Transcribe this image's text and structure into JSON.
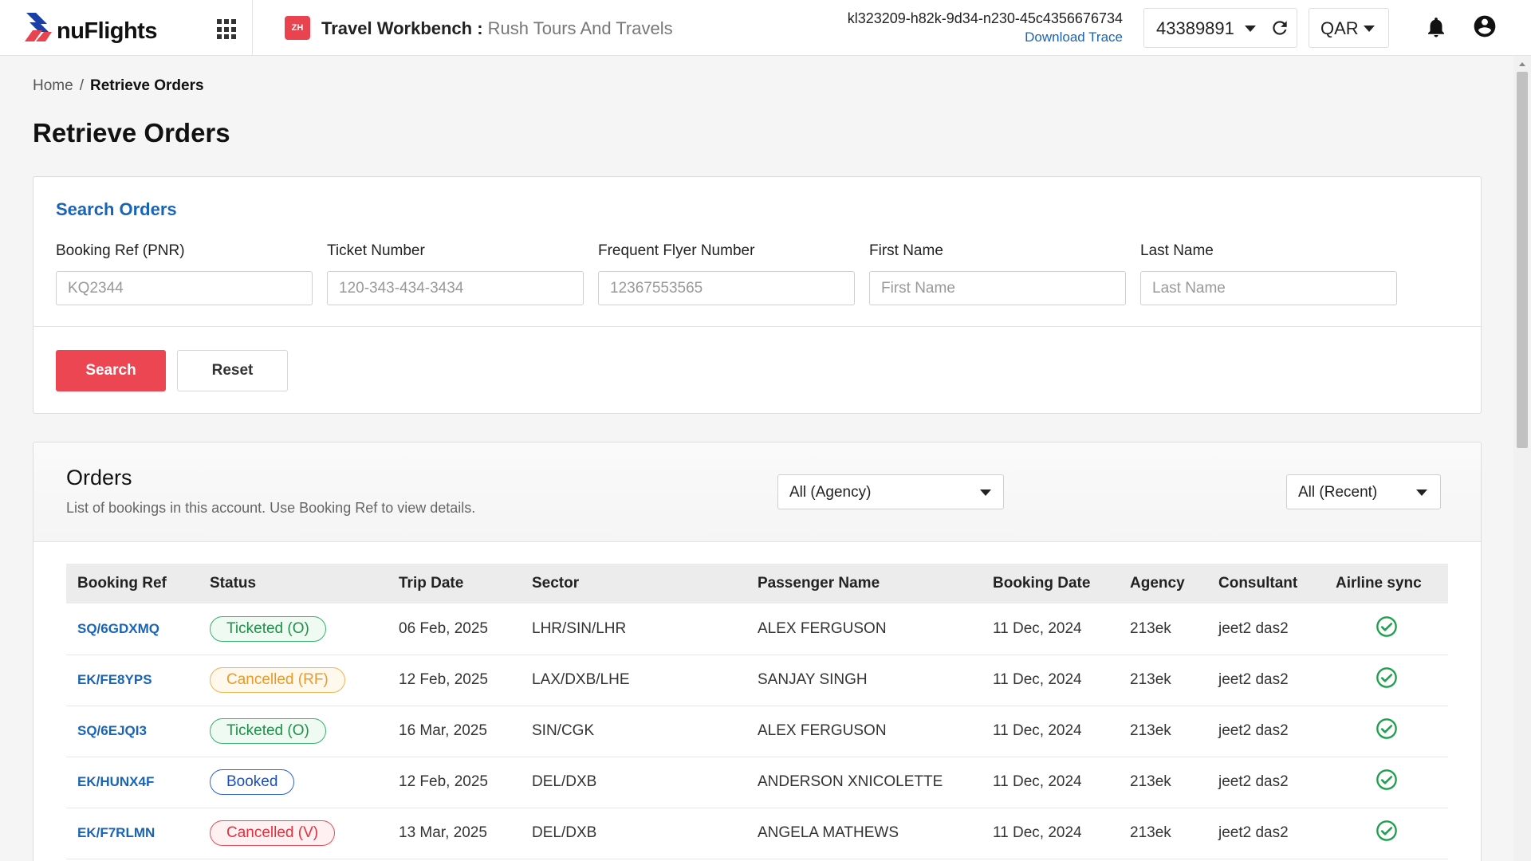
{
  "app": {
    "logo_text": "nuFlights",
    "workbench_icon_text": "ZH",
    "workbench_title": "Travel Workbench :",
    "agency_name": "Rush Tours And Travels",
    "trace_id": "kl323209-h82k-9d34-n230-45c4356676734",
    "download_trace_label": "Download Trace",
    "account_number": "43389891",
    "currency": "QAR"
  },
  "icons": {
    "apps": "grid-icon",
    "refresh": "refresh-icon",
    "notifications": "bell-icon",
    "user": "user-icon",
    "sync": "check-circle-icon"
  },
  "breadcrumb": {
    "home": "Home",
    "separator": "/",
    "current": "Retrieve Orders"
  },
  "page_title": "Retrieve Orders",
  "search": {
    "heading": "Search Orders",
    "fields": [
      {
        "label": "Booking Ref (PNR)",
        "placeholder": "KQ2344",
        "value": ""
      },
      {
        "label": "Ticket Number",
        "placeholder": "120-343-434-3434",
        "value": ""
      },
      {
        "label": "Frequent Flyer Number",
        "placeholder": "12367553565",
        "value": ""
      },
      {
        "label": "First Name",
        "placeholder": "First Name",
        "value": ""
      },
      {
        "label": "Last Name",
        "placeholder": "Last Name",
        "value": ""
      }
    ],
    "search_label": "Search",
    "reset_label": "Reset"
  },
  "orders": {
    "title": "Orders",
    "subtitle": "List of bookings in this account. Use Booking Ref to view details.",
    "agency_filter": "All (Agency)",
    "recent_filter": "All (Recent)",
    "columns": [
      "Booking Ref",
      "Status",
      "Trip Date",
      "Sector",
      "Passenger Name",
      "Booking Date",
      "Agency",
      "Consultant",
      "Airline sync"
    ],
    "rows": [
      {
        "ref": "SQ/6GDXMQ",
        "status": "Ticketed (O)",
        "status_kind": "ticketed",
        "trip_date": "06 Feb, 2025",
        "sector": "LHR/SIN/LHR",
        "passenger": "ALEX FERGUSON",
        "booking_date": "11 Dec, 2024",
        "agency": "213ek",
        "consultant": "jeet2 das2"
      },
      {
        "ref": "EK/FE8YPS",
        "status": "Cancelled (RF)",
        "status_kind": "cancelled-rf",
        "trip_date": "12 Feb, 2025",
        "sector": "LAX/DXB/LHE",
        "passenger": "SANJAY SINGH",
        "booking_date": "11 Dec, 2024",
        "agency": "213ek",
        "consultant": "jeet2 das2"
      },
      {
        "ref": "SQ/6EJQI3",
        "status": "Ticketed (O)",
        "status_kind": "ticketed",
        "trip_date": "16 Mar, 2025",
        "sector": "SIN/CGK",
        "passenger": "ALEX FERGUSON",
        "booking_date": "11 Dec, 2024",
        "agency": "213ek",
        "consultant": "jeet2 das2"
      },
      {
        "ref": "EK/HUNX4F",
        "status": "Booked",
        "status_kind": "booked",
        "trip_date": "12 Feb, 2025",
        "sector": "DEL/DXB",
        "passenger": "ANDERSON XNICOLETTE",
        "booking_date": "11 Dec, 2024",
        "agency": "213ek",
        "consultant": "jeet2 das2"
      },
      {
        "ref": "EK/F7RLMN",
        "status": "Cancelled (V)",
        "status_kind": "cancelled-v",
        "trip_date": "13 Mar, 2025",
        "sector": "DEL/DXB",
        "passenger": "ANGELA MATHEWS",
        "booking_date": "11 Dec, 2024",
        "agency": "213ek",
        "consultant": "jeet2 das2"
      }
    ]
  },
  "colors": {
    "brand_red": "#ec4653",
    "link_blue": "#1a64b6",
    "sync_green": "#1fa04d"
  }
}
